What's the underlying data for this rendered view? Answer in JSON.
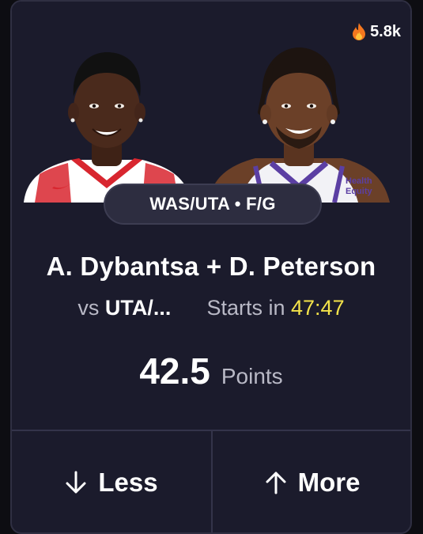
{
  "card": {
    "popularity": {
      "icon": "fire-icon",
      "count": "5.8k"
    },
    "players": [
      {
        "name": "A. Dybantsa",
        "jersey_color": "#ffffff",
        "trim_color": "#d8262f",
        "skin_color": "#4a2a1c"
      },
      {
        "name": "D. Peterson",
        "jersey_color": "#f2f2f6",
        "trim_color": "#5b3fa3",
        "skin_color": "#6b4028",
        "jersey_text": [
          "Health",
          "Equity"
        ]
      }
    ],
    "matchup": "WAS/UTA • F/G",
    "player_names": "A. Dybantsa + D. Peterson",
    "opponent_prefix": "vs",
    "opponent": "UTA/...",
    "starts_label": "Starts in",
    "countdown": "47:47",
    "line_value": "42.5",
    "stat_type": "Points",
    "buttons": {
      "less_icon": "arrow-down-icon",
      "less_label": "Less",
      "more_icon": "arrow-up-icon",
      "more_label": "More"
    },
    "colors": {
      "card_bg": "#1b1b2c",
      "countdown": "#f4e34a",
      "muted_text": "#b9b9c6"
    }
  }
}
